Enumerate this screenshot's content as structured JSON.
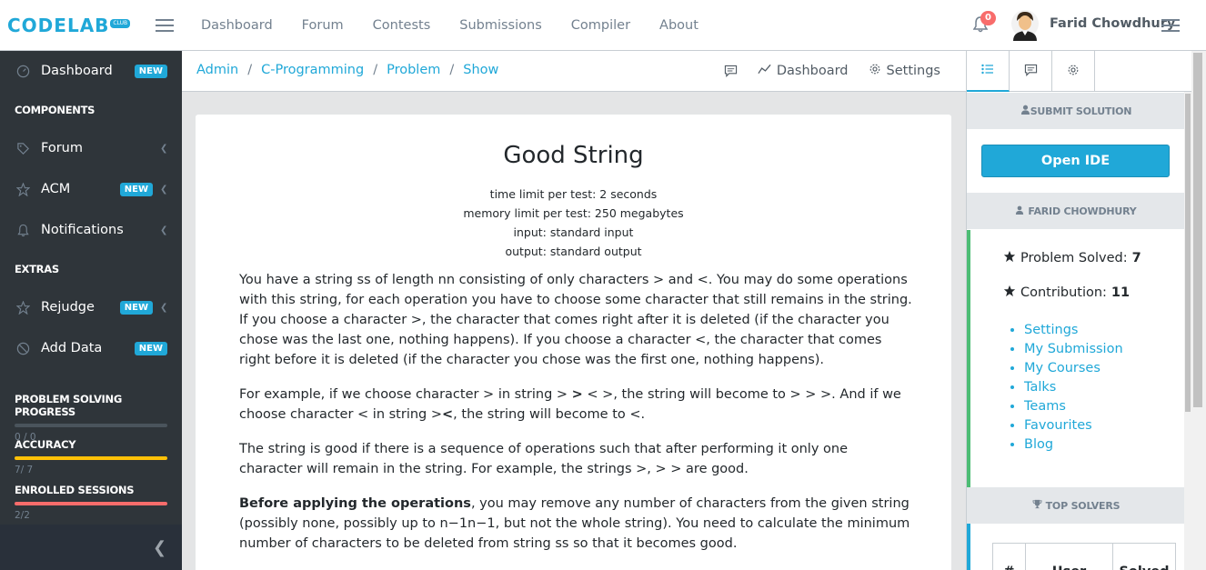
{
  "brand": {
    "name": "CODELAB",
    "sup": "CLUB"
  },
  "topnav": [
    "Dashboard",
    "Forum",
    "Contests",
    "Submissions",
    "Compiler",
    "About"
  ],
  "notifications": {
    "count": "0"
  },
  "user": {
    "name": "Farid Chowdhury"
  },
  "sidebar": {
    "dashboard": {
      "label": "Dashboard",
      "badge": "NEW"
    },
    "components_title": "COMPONENTS",
    "forum": {
      "label": "Forum"
    },
    "acm": {
      "label": "ACM",
      "badge": "NEW"
    },
    "notifications": {
      "label": "Notifications"
    },
    "extras_title": "EXTRAS",
    "rejudge": {
      "label": "Rejudge",
      "badge": "NEW"
    },
    "add_data": {
      "label": "Add Data",
      "badge": "NEW"
    },
    "progress": [
      {
        "title": "PROBLEM SOLVING PROGRESS",
        "value": "0 / 0",
        "fill": 0,
        "color": "#73818f"
      },
      {
        "title": "ACCURACY",
        "value": "7/ 7",
        "fill": 1.0,
        "color": "#ffc107"
      },
      {
        "title": "ENROLLED SESSIONS",
        "value": "2/2",
        "fill": 1.0,
        "color": "#f86c6b"
      }
    ]
  },
  "breadcrumb": [
    "Admin",
    "C-Programming",
    "Problem",
    "Show"
  ],
  "crumb_actions": {
    "dashboard": "Dashboard",
    "settings": "Settings"
  },
  "problem": {
    "title": "Good String",
    "time_limit": "time limit per test: 2 seconds",
    "memory_limit": "memory limit per test: 250 megabytes",
    "input": "input: standard input",
    "output": "output: standard output",
    "p1": "You have a string ss of length nn consisting of only characters > and <. You may do some operations with this string, for each operation you have to choose some character that still remains in the string. If you choose a character >, the character that comes right after it is deleted (if the character you chose was the last one, nothing happens). If you choose a character <, the character that comes right before it is deleted (if the character you chose was the first one, nothing happens).",
    "p2a": "For example, if we choose character > in string > ",
    "p2b": ">",
    "p2c": " < >, the string will become to > > >. And if we choose character < in string >",
    "p2d": "<",
    "p2e": ", the string will become to <.",
    "p3": "The string is good if there is a sequence of operations such that after performing it only one character will remain in the string. For example, the strings >, > > are good.",
    "p4_bold": "Before applying the operations",
    "p4_rest": ", you may remove any number of characters from the given string (possibly none, possibly up to n−1n−1, but not the whole string). You need to calculate the minimum number of characters to be deleted from string ss so that it becomes good."
  },
  "aside": {
    "submit_head": "SUBMIT SOLUTION",
    "open_ide": "Open IDE",
    "user_head": "FARID CHOWDHURY",
    "solved_label": "Problem Solved:",
    "solved_value": "7",
    "contrib_label": "Contribution:",
    "contrib_value": "11",
    "links": [
      "Settings",
      "My Submission",
      "My Courses",
      "Talks",
      "Teams",
      "Favourites",
      "Blog"
    ],
    "solvers_head": "TOP SOLVERS",
    "table_headers": [
      "#",
      "User",
      "Solved"
    ]
  }
}
